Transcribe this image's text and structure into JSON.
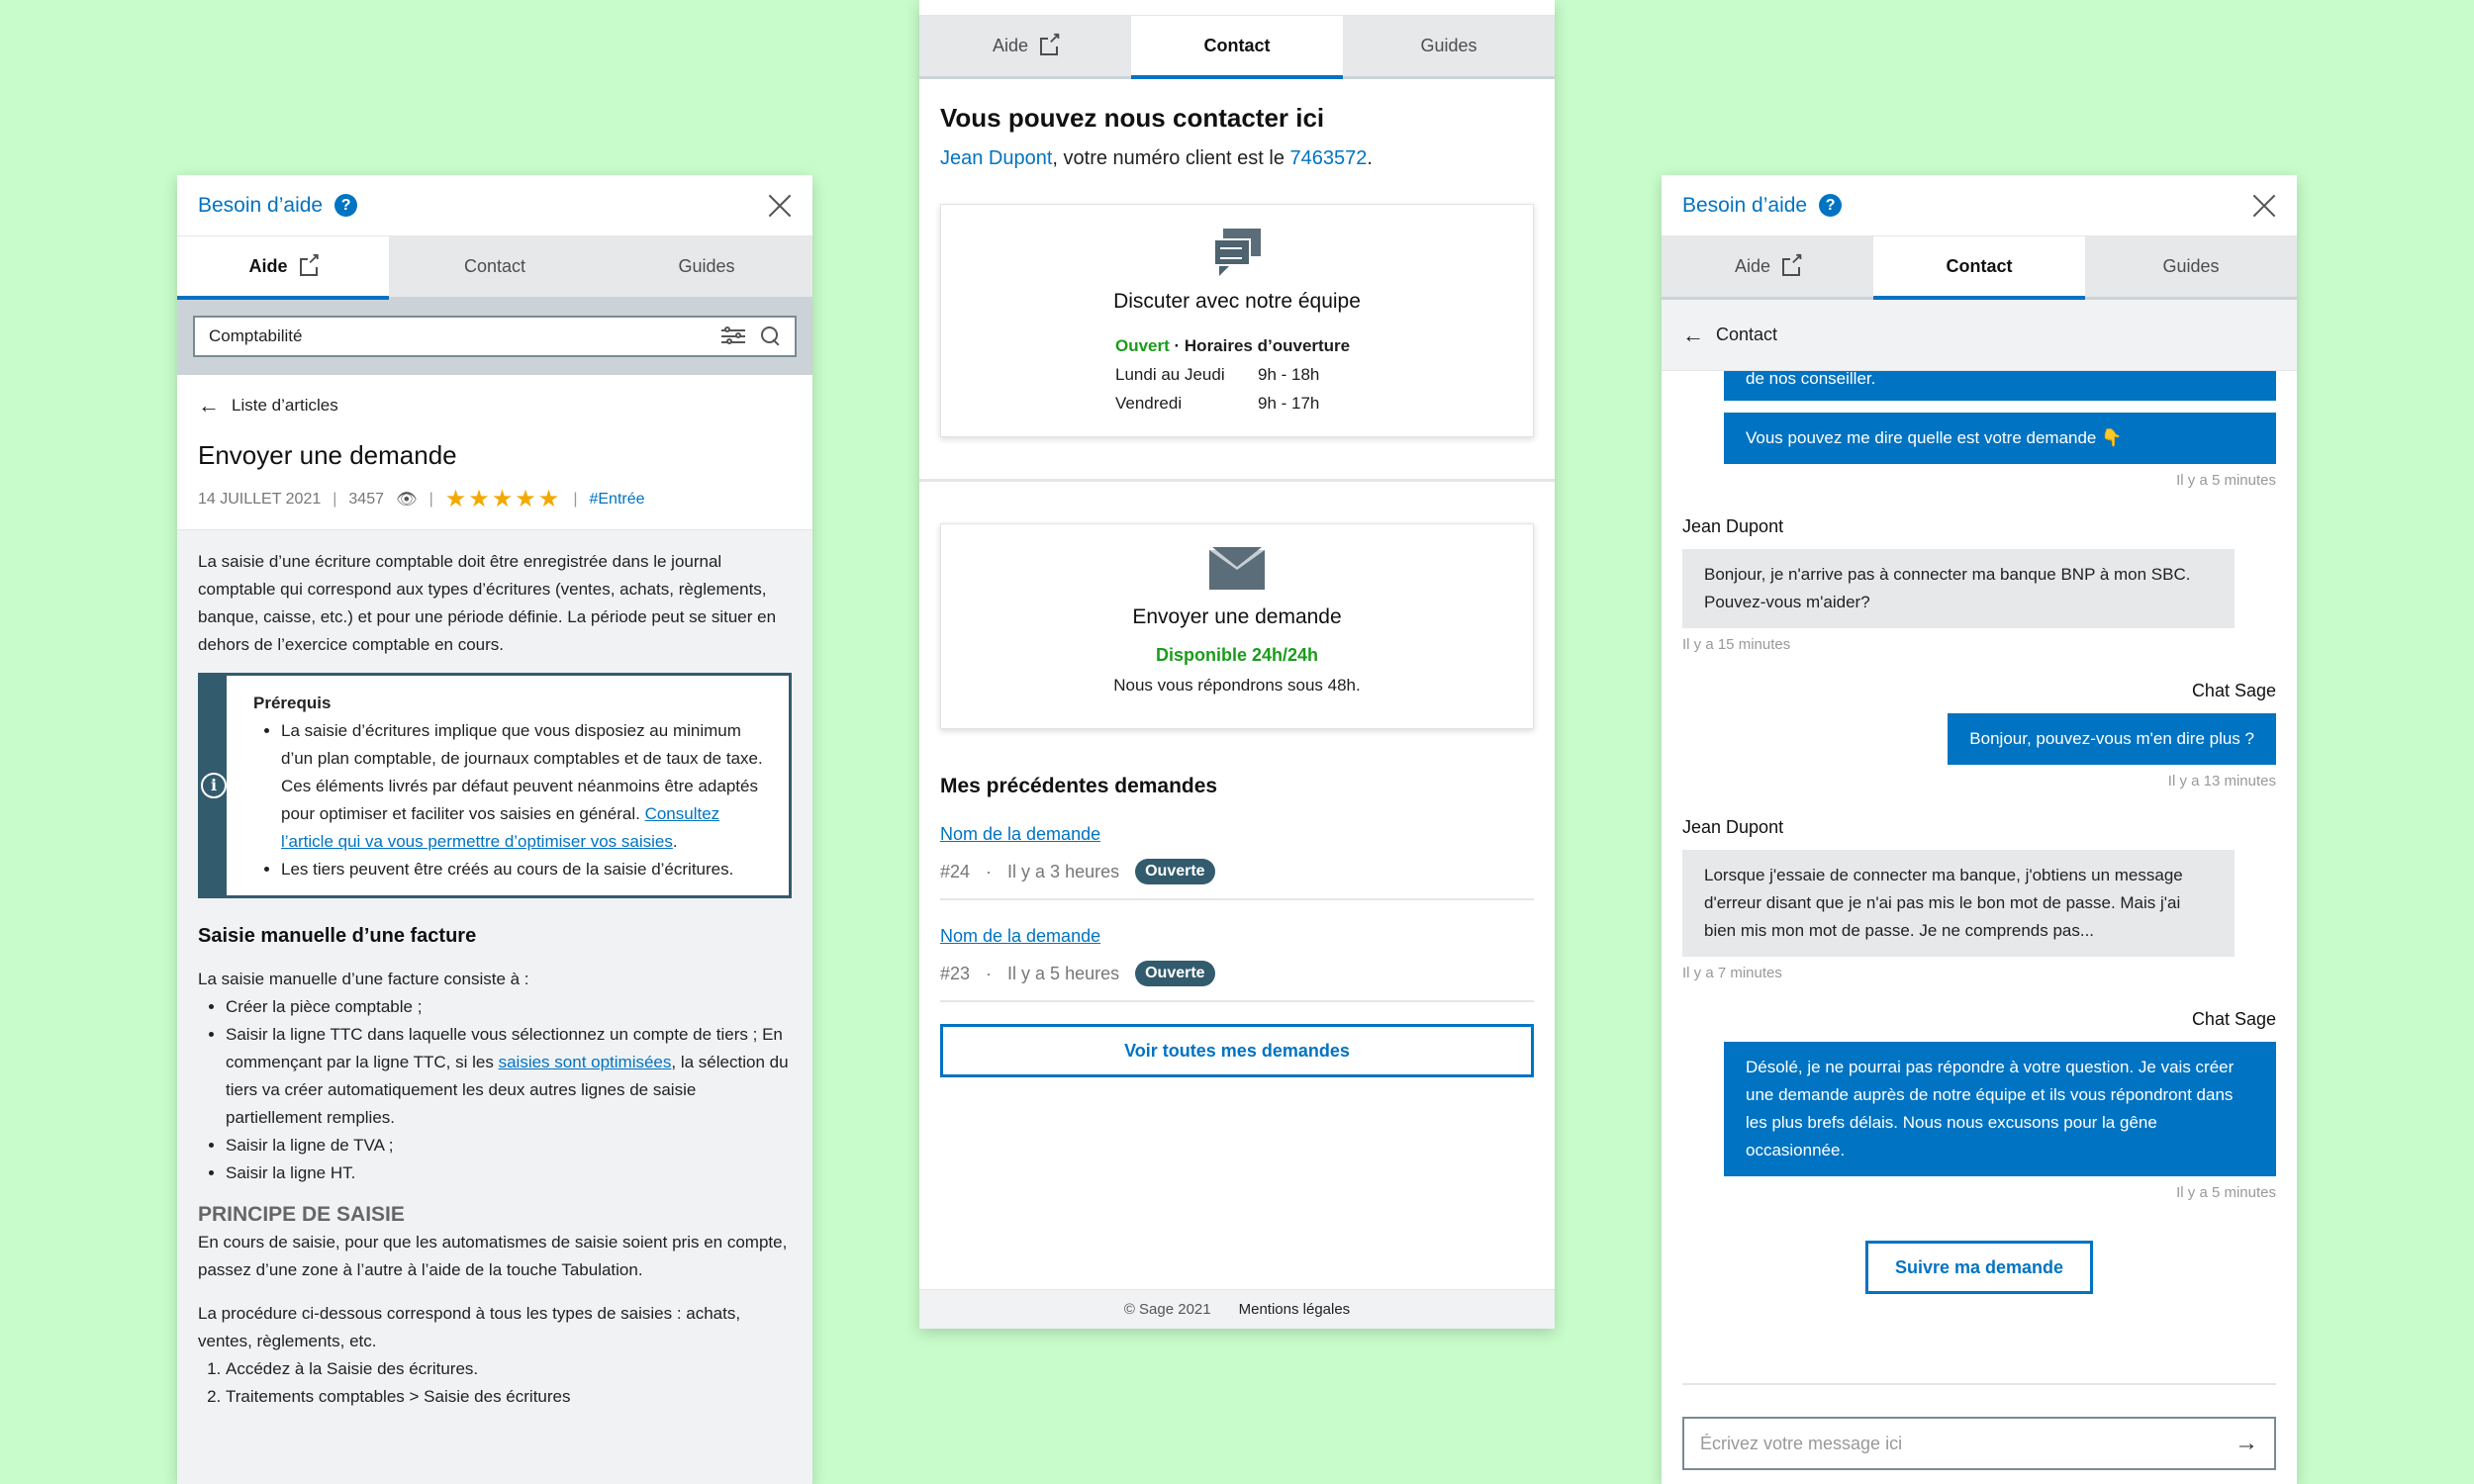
{
  "colors": {
    "background": "#c8fcca",
    "accent": "#0073c2",
    "success": "#1a9c1a",
    "badge": "#335b6e",
    "stars": "#f2a900"
  },
  "help_header": {
    "title": "Besoin d’aide",
    "help_icon": "question-circle-icon",
    "close_icon": "close-icon"
  },
  "tabs": {
    "aide": "Aide",
    "contact": "Contact",
    "guides": "Guides"
  },
  "left": {
    "search_value": "Comptabilité",
    "back_label": "Liste d’articles",
    "title": "Envoyer une demande",
    "date": "14 JUILLET 2021",
    "views": "3457",
    "rating": 5,
    "stars": "★★★★★",
    "tag": "#Entrée",
    "intro": "La saisie d’une écriture comptable doit être enregistrée dans le journal comptable qui correspond aux types d’écritures (ventes, achats, règlements, banque, caisse, etc.) et pour une période définie. La période peut se situer en dehors de l’exercice comptable en cours.",
    "prereq_title": "Prérequis",
    "prereq_item1_text": "La saisie d’écritures implique que vous disposiez au minimum d’un plan comptable, de journaux comptables et de taux de taxe. Ces éléments livrés par défaut peuvent néanmoins être adaptés pour optimiser et faciliter vos saisies en général.",
    "prereq_item1_link": "Consultez l’article qui va vous permettre d’optimiser vos saisies",
    "prereq_item2": "Les tiers peuvent être créés au cours de la saisie d’écritures.",
    "section_title": "Saisie manuelle d’une facture",
    "section_intro": "La saisie manuelle d’une facture consiste à :",
    "list1": "Créer la pièce comptable ;",
    "list2_text": "Saisir la ligne TTC dans laquelle vous sélectionnez un compte de tiers ; En commençant par la ligne TTC, si les",
    "list2_link": "saisies sont optimisées",
    "list2_tail": ", la sélection du tiers va créer automatiquement les deux autres lignes de saisie partiellement remplies.",
    "list3": "Saisir la ligne de TVA ;",
    "list4": "Saisir la ligne HT.",
    "principle_title": "PRINCIPE DE SAISIE",
    "principle_text": "En cours de saisie, pour que les automatismes de saisie soient pris en compte, passez d’une zone à l’autre à l’aide de la touche Tabulation.",
    "procedure_text": "La procédure ci-dessous correspond à tous les types de saisies : achats, ventes, règlements, etc.",
    "step1": "Accédez à la Saisie des écritures.",
    "step2": "Traitements comptables > Saisie des écritures"
  },
  "middle": {
    "title": "Vous pouvez nous contacter ici",
    "user_name": "Jean Dupont",
    "client_text": ", votre numéro client est le ",
    "client_number": "7463572",
    "chat_card": {
      "icon": "chat-bubbles-icon",
      "title": "Discuter avec notre équipe",
      "status": "Ouvert",
      "status_sep": " · ",
      "hours_label": "Horaires d’ouverture",
      "day1": "Lundi au Jeudi",
      "hours1": "9h - 18h",
      "day2": "Vendredi",
      "hours2": "9h - 17h"
    },
    "mail_card": {
      "icon": "envelope-icon",
      "title": "Envoyer une demande",
      "availability": "Disponible 24h/24h",
      "note": "Nous vous répondrons sous 48h."
    },
    "previous_title": "Mes précédentes demandes",
    "requests": [
      {
        "name": "Nom de la demande",
        "id": "#24",
        "sep": "·",
        "time": "Il y a 3 heures",
        "status": "Ouverte"
      },
      {
        "name": "Nom de la demande",
        "id": "#23",
        "sep": "·",
        "time": "Il y a 5 heures",
        "status": "Ouverte"
      }
    ],
    "see_all": "Voir toutes mes demandes",
    "footer_copyright": "© Sage 2021",
    "footer_legal": "Mentions légales"
  },
  "right": {
    "back_label": "Contact",
    "partial_msg": "de nos conseiller.",
    "msg1": "Vous pouvez me dire quelle est votre demande 👇",
    "msg1_time": "Il y a 5 minutes",
    "sender_user": "Jean Dupont",
    "msg2": "Bonjour, je n'arrive pas à connecter ma banque BNP à mon SBC. Pouvez-vous m'aider?",
    "msg2_time": "Il y a 15 minutes",
    "sender_bot": "Chat Sage",
    "msg3": "Bonjour, pouvez-vous m'en dire plus ?",
    "msg3_time": "Il y a 13 minutes",
    "msg4": "Lorsque j'essaie de connecter ma banque, j'obtiens un message d'erreur disant que je n'ai pas mis le bon mot de passe. Mais j'ai bien mis mon mot de passe. Je ne comprends pas...",
    "msg4_time": "Il y a 7 minutes",
    "msg5": "Désolé, je ne pourrai pas répondre à votre question. Je vais créer une demande auprès de notre équipe et ils vous répondront dans les plus brefs délais. Nous nous excusons pour la gêne occasionnée.",
    "msg5_time": "Il y a 5 minutes",
    "follow_button": "Suivre ma demande",
    "input_placeholder": "Écrivez votre message ici",
    "send_icon": "arrow-right-icon"
  }
}
